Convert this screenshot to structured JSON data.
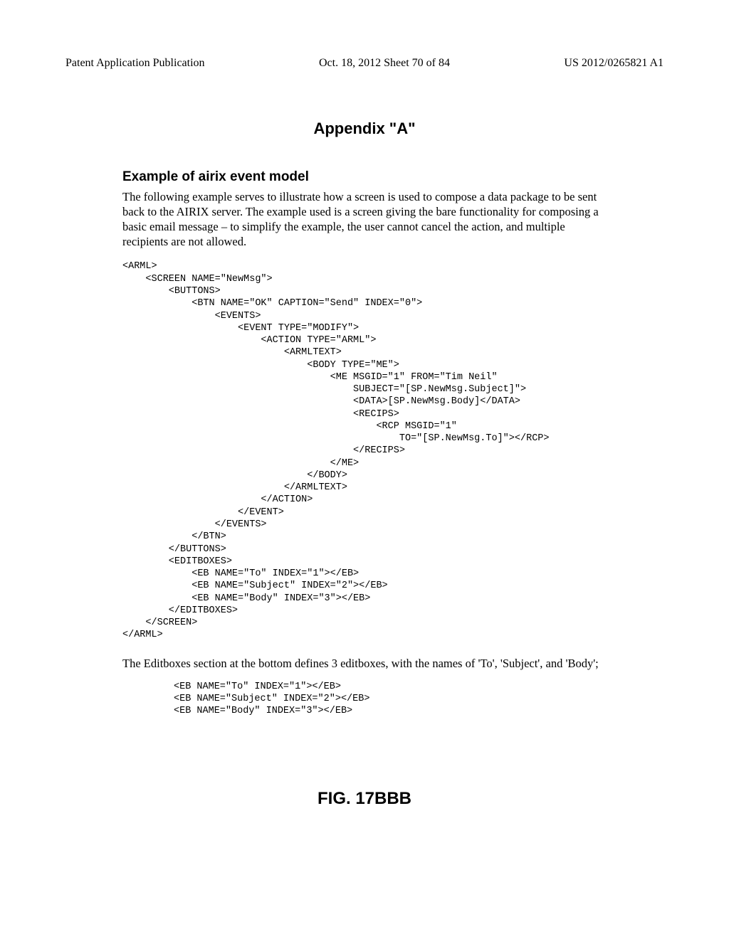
{
  "header": {
    "left": "Patent Application Publication",
    "center": "Oct. 18, 2012  Sheet 70 of 84",
    "right": "US 2012/0265821 A1"
  },
  "appendix_title": "Appendix \"A\"",
  "section_heading": "Example of airix event model",
  "intro_paragraph": "The following example serves to illustrate how a screen is used to compose a data package to be sent back to the AIRIX server. The example used is a screen giving the bare functionality for composing a basic email message – to simplify the example, the user cannot cancel the action, and multiple recipients are not allowed.",
  "code_block_1": "<ARML>\n    <SCREEN NAME=\"NewMsg\">\n        <BUTTONS>\n            <BTN NAME=\"OK\" CAPTION=\"Send\" INDEX=\"0\">\n                <EVENTS>\n                    <EVENT TYPE=\"MODIFY\">\n                        <ACTION TYPE=\"ARML\">\n                            <ARMLTEXT>\n                                <BODY TYPE=\"ME\">\n                                    <ME MSGID=\"1\" FROM=\"Tim Neil\"\n                                        SUBJECT=\"[SP.NewMsg.Subject]\">\n                                        <DATA>[SP.NewMsg.Body]</DATA>\n                                        <RECIPS>\n                                            <RCP MSGID=\"1\"\n                                                TO=\"[SP.NewMsg.To]\"></RCP>\n                                        </RECIPS>\n                                    </ME>\n                                </BODY>\n                            </ARMLTEXT>\n                        </ACTION>\n                    </EVENT>\n                </EVENTS>\n            </BTN>\n        </BUTTONS>\n        <EDITBOXES>\n            <EB NAME=\"To\" INDEX=\"1\"></EB>\n            <EB NAME=\"Subject\" INDEX=\"2\"></EB>\n            <EB NAME=\"Body\" INDEX=\"3\"></EB>\n        </EDITBOXES>\n    </SCREEN>\n</ARML>",
  "mid_paragraph": "The Editboxes section at the bottom defines 3 editboxes, with the names of 'To', 'Subject', and 'Body';",
  "code_block_2": "<EB NAME=\"To\" INDEX=\"1\"></EB>\n<EB NAME=\"Subject\" INDEX=\"2\"></EB>\n<EB NAME=\"Body\" INDEX=\"3\"></EB>",
  "figure_label": "FIG. 17BBB"
}
